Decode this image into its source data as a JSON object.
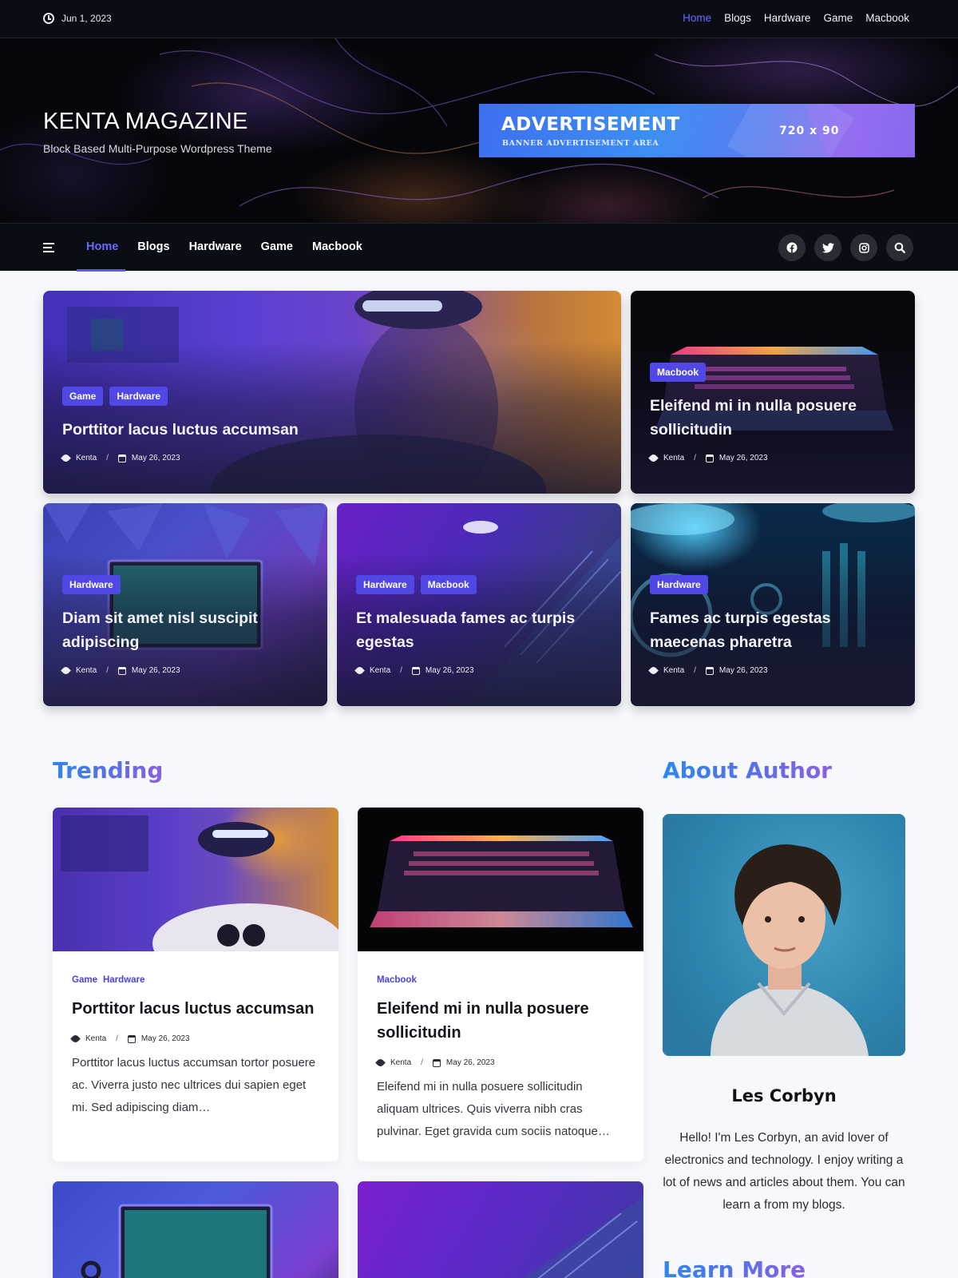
{
  "topbar": {
    "date": "Jun 1, 2023",
    "clock_icon": "clock-icon",
    "nav": [
      "Home",
      "Blogs",
      "Hardware",
      "Game",
      "Macbook"
    ],
    "active": "Home"
  },
  "header": {
    "title": "KENTA MAGAZINE",
    "tagline": "Block Based Multi-Purpose Wordpress Theme",
    "ad": {
      "title": "ADVERTISEMENT",
      "subtitle": "Banner Advertisement Area",
      "size": "720 x 90"
    }
  },
  "mainnav": {
    "items": [
      "Home",
      "Blogs",
      "Hardware",
      "Game",
      "Macbook"
    ],
    "active": "Home",
    "socials": [
      "facebook-icon",
      "twitter-icon",
      "instagram-icon",
      "search-icon"
    ]
  },
  "featured": [
    {
      "tags": [
        "Game",
        "Hardware"
      ],
      "title": "Porttitor lacus luctus accumsan",
      "author": "Kenta",
      "date": "May 26, 2023"
    },
    {
      "tags": [
        "Macbook"
      ],
      "title": "Eleifend mi in nulla posuere sollicitudin",
      "author": "Kenta",
      "date": "May 26, 2023"
    },
    {
      "tags": [
        "Hardware"
      ],
      "title": "Diam sit amet nisl suscipit adipiscing",
      "author": "Kenta",
      "date": "May 26, 2023"
    },
    {
      "tags": [
        "Hardware",
        "Macbook"
      ],
      "title": "Et malesuada fames ac turpis egestas",
      "author": "Kenta",
      "date": "May 26, 2023"
    },
    {
      "tags": [
        "Hardware"
      ],
      "title": "Fames ac turpis egestas maecenas pharetra",
      "author": "Kenta",
      "date": "May 26, 2023"
    }
  ],
  "trending": {
    "heading": "Trending",
    "cards": [
      {
        "tags": [
          "Game",
          "Hardware"
        ],
        "title": "Porttitor lacus luctus accumsan",
        "author": "Kenta",
        "date": "May 26, 2023",
        "excerpt": "Porttitor lacus luctus accumsan tortor posuere ac. Viverra justo nec ultrices dui sapien eget mi. Sed adipiscing diam…"
      },
      {
        "tags": [
          "Macbook"
        ],
        "title": "Eleifend mi in nulla posuere sollicitudin",
        "author": "Kenta",
        "date": "May 26, 2023",
        "excerpt": "Eleifend mi in nulla posuere sollicitudin aliquam ultrices. Quis viverra nibh cras pulvinar. Eget gravida cum sociis natoque…"
      }
    ]
  },
  "about": {
    "heading": "About Author",
    "name": "Les Corbyn",
    "bio": "Hello! I'm Les Corbyn, an avid lover of electronics and technology. I enjoy writing a lot of news and articles about them. You can learn a from my blogs.",
    "learn_more": "Learn More"
  },
  "colors": {
    "accent": "#5048e5",
    "nav_active": "#6b68ff",
    "dark": "#0b0d14",
    "heading_gradient": [
      "#2e86f1",
      "#8b5fe5"
    ]
  }
}
